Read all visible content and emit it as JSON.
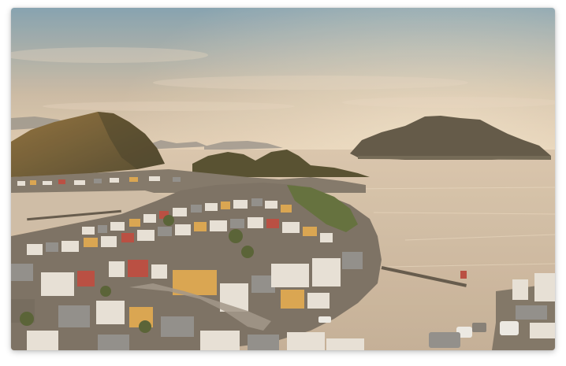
{
  "photo": {
    "subject": "harbor-town-aerial-view",
    "palette": {
      "sky_top": "#7f9fb0",
      "sky_mid": "#c9b9a3",
      "sky_horizon": "#e4cfb5",
      "water": "#d8c5ad",
      "hills": "#4a4228",
      "hill_highlight": "#8a6a35",
      "rooftops_red": "#b6453a",
      "rooftops_yellow": "#d8a24a",
      "rooftops_gray": "#8b8a88",
      "buildings_light": "#e6e1d8"
    }
  }
}
